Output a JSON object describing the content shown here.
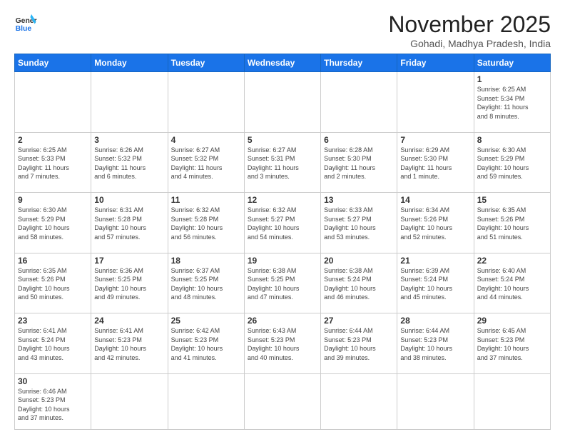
{
  "header": {
    "logo_general": "General",
    "logo_blue": "Blue",
    "month_title": "November 2025",
    "subtitle": "Gohadi, Madhya Pradesh, India"
  },
  "weekdays": [
    "Sunday",
    "Monday",
    "Tuesday",
    "Wednesday",
    "Thursday",
    "Friday",
    "Saturday"
  ],
  "weeks": [
    [
      {
        "day": "",
        "info": "",
        "empty": true
      },
      {
        "day": "",
        "info": "",
        "empty": true
      },
      {
        "day": "",
        "info": "",
        "empty": true
      },
      {
        "day": "",
        "info": "",
        "empty": true
      },
      {
        "day": "",
        "info": "",
        "empty": true
      },
      {
        "day": "",
        "info": "",
        "empty": true
      },
      {
        "day": "1",
        "info": "Sunrise: 6:25 AM\nSunset: 5:34 PM\nDaylight: 11 hours\nand 8 minutes."
      }
    ],
    [
      {
        "day": "2",
        "info": "Sunrise: 6:25 AM\nSunset: 5:33 PM\nDaylight: 11 hours\nand 7 minutes."
      },
      {
        "day": "3",
        "info": "Sunrise: 6:26 AM\nSunset: 5:32 PM\nDaylight: 11 hours\nand 6 minutes."
      },
      {
        "day": "4",
        "info": "Sunrise: 6:27 AM\nSunset: 5:32 PM\nDaylight: 11 hours\nand 4 minutes."
      },
      {
        "day": "5",
        "info": "Sunrise: 6:27 AM\nSunset: 5:31 PM\nDaylight: 11 hours\nand 3 minutes."
      },
      {
        "day": "6",
        "info": "Sunrise: 6:28 AM\nSunset: 5:30 PM\nDaylight: 11 hours\nand 2 minutes."
      },
      {
        "day": "7",
        "info": "Sunrise: 6:29 AM\nSunset: 5:30 PM\nDaylight: 11 hours\nand 1 minute."
      },
      {
        "day": "8",
        "info": "Sunrise: 6:30 AM\nSunset: 5:29 PM\nDaylight: 10 hours\nand 59 minutes."
      }
    ],
    [
      {
        "day": "9",
        "info": "Sunrise: 6:30 AM\nSunset: 5:29 PM\nDaylight: 10 hours\nand 58 minutes."
      },
      {
        "day": "10",
        "info": "Sunrise: 6:31 AM\nSunset: 5:28 PM\nDaylight: 10 hours\nand 57 minutes."
      },
      {
        "day": "11",
        "info": "Sunrise: 6:32 AM\nSunset: 5:28 PM\nDaylight: 10 hours\nand 56 minutes."
      },
      {
        "day": "12",
        "info": "Sunrise: 6:32 AM\nSunset: 5:27 PM\nDaylight: 10 hours\nand 54 minutes."
      },
      {
        "day": "13",
        "info": "Sunrise: 6:33 AM\nSunset: 5:27 PM\nDaylight: 10 hours\nand 53 minutes."
      },
      {
        "day": "14",
        "info": "Sunrise: 6:34 AM\nSunset: 5:26 PM\nDaylight: 10 hours\nand 52 minutes."
      },
      {
        "day": "15",
        "info": "Sunrise: 6:35 AM\nSunset: 5:26 PM\nDaylight: 10 hours\nand 51 minutes."
      }
    ],
    [
      {
        "day": "16",
        "info": "Sunrise: 6:35 AM\nSunset: 5:26 PM\nDaylight: 10 hours\nand 50 minutes."
      },
      {
        "day": "17",
        "info": "Sunrise: 6:36 AM\nSunset: 5:25 PM\nDaylight: 10 hours\nand 49 minutes."
      },
      {
        "day": "18",
        "info": "Sunrise: 6:37 AM\nSunset: 5:25 PM\nDaylight: 10 hours\nand 48 minutes."
      },
      {
        "day": "19",
        "info": "Sunrise: 6:38 AM\nSunset: 5:25 PM\nDaylight: 10 hours\nand 47 minutes."
      },
      {
        "day": "20",
        "info": "Sunrise: 6:38 AM\nSunset: 5:24 PM\nDaylight: 10 hours\nand 46 minutes."
      },
      {
        "day": "21",
        "info": "Sunrise: 6:39 AM\nSunset: 5:24 PM\nDaylight: 10 hours\nand 45 minutes."
      },
      {
        "day": "22",
        "info": "Sunrise: 6:40 AM\nSunset: 5:24 PM\nDaylight: 10 hours\nand 44 minutes."
      }
    ],
    [
      {
        "day": "23",
        "info": "Sunrise: 6:41 AM\nSunset: 5:24 PM\nDaylight: 10 hours\nand 43 minutes."
      },
      {
        "day": "24",
        "info": "Sunrise: 6:41 AM\nSunset: 5:23 PM\nDaylight: 10 hours\nand 42 minutes."
      },
      {
        "day": "25",
        "info": "Sunrise: 6:42 AM\nSunset: 5:23 PM\nDaylight: 10 hours\nand 41 minutes."
      },
      {
        "day": "26",
        "info": "Sunrise: 6:43 AM\nSunset: 5:23 PM\nDaylight: 10 hours\nand 40 minutes."
      },
      {
        "day": "27",
        "info": "Sunrise: 6:44 AM\nSunset: 5:23 PM\nDaylight: 10 hours\nand 39 minutes."
      },
      {
        "day": "28",
        "info": "Sunrise: 6:44 AM\nSunset: 5:23 PM\nDaylight: 10 hours\nand 38 minutes."
      },
      {
        "day": "29",
        "info": "Sunrise: 6:45 AM\nSunset: 5:23 PM\nDaylight: 10 hours\nand 37 minutes."
      }
    ],
    [
      {
        "day": "30",
        "info": "Sunrise: 6:46 AM\nSunset: 5:23 PM\nDaylight: 10 hours\nand 37 minutes."
      },
      {
        "day": "",
        "info": "",
        "empty": true
      },
      {
        "day": "",
        "info": "",
        "empty": true
      },
      {
        "day": "",
        "info": "",
        "empty": true
      },
      {
        "day": "",
        "info": "",
        "empty": true
      },
      {
        "day": "",
        "info": "",
        "empty": true
      },
      {
        "day": "",
        "info": "",
        "empty": true
      }
    ]
  ]
}
